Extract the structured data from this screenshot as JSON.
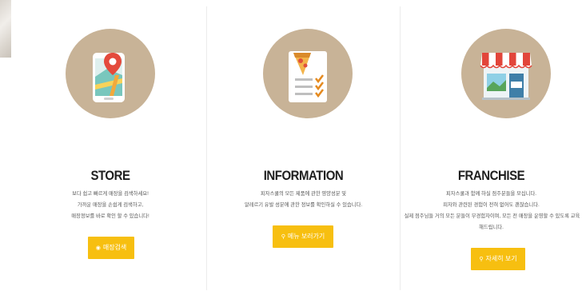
{
  "cards": [
    {
      "title": "STORE",
      "desc": [
        "보다 쉽고 빠르게 매장을 검색하세요!",
        "가까운 매장을 손쉽게 검색하고,",
        "매장정보를 바로 확인 할 수 있습니다!"
      ],
      "button": "매장검색",
      "icon": "store-locator-phone-icon"
    },
    {
      "title": "INFORMATION",
      "desc": [
        "피자스쿨의 모든 제품에 관한 영양성분 및",
        "알레르기 유발 성분에 관한 정보를 확인하실 수 있습니다."
      ],
      "button": "메뉴 보러가기",
      "icon": "pizza-checklist-icon"
    },
    {
      "title": "FRANCHISE",
      "desc": [
        "피자스쿨과 함께 하실 점주분들을 모십니다.",
        "피자와 관련된 경험이 전혀 없어도 괜찮습니다.",
        "실제 점주님들 거의 모든 분들이 무경험자이며, 모든 전 매장을 운영할 수 있도록 교육",
        "해드립니다."
      ],
      "button": "자세히 보기",
      "icon": "storefront-open-icon"
    }
  ],
  "colors": {
    "circle": "#c8b397",
    "button": "#f7bf10",
    "button_text": "#ffffff"
  }
}
